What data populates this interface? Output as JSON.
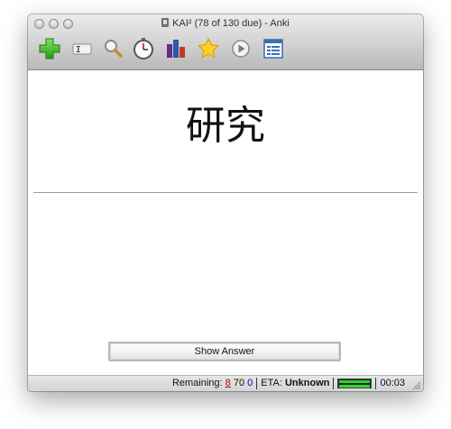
{
  "window": {
    "title": "KAI² (78 of 130 due) - Anki"
  },
  "toolbar": {
    "items": [
      {
        "name": "add-icon"
      },
      {
        "name": "edit-icon"
      },
      {
        "name": "search-icon"
      },
      {
        "name": "timer-icon"
      },
      {
        "name": "stats-icon"
      },
      {
        "name": "star-icon"
      },
      {
        "name": "play-icon"
      },
      {
        "name": "list-icon"
      }
    ]
  },
  "card": {
    "question": "研究"
  },
  "buttons": {
    "show_answer": "Show Answer"
  },
  "status": {
    "remaining_label": "Remaining:",
    "remaining_new": "8",
    "remaining_review": "70",
    "remaining_learn": "0",
    "eta_label": "ETA:",
    "eta_value": "Unknown",
    "timer": "00:03",
    "colors": {
      "new": "#c00000",
      "learn": "#0000cc",
      "progress": "#2bd82b"
    }
  }
}
